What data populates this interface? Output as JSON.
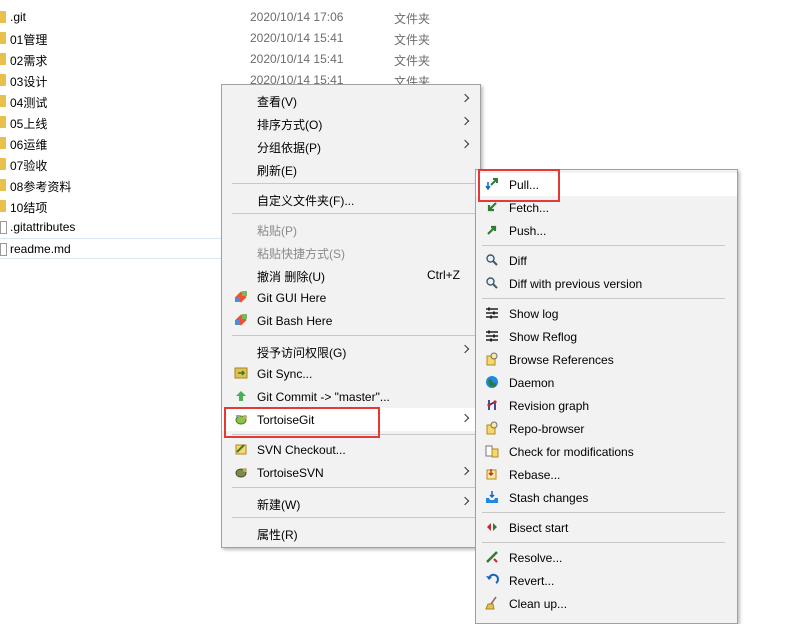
{
  "files": [
    {
      "name": ".git",
      "date": "2020/10/14 17:06",
      "type": "文件夹",
      "icon": "folder-icon"
    },
    {
      "name": "01管理",
      "date": "2020/10/14 15:41",
      "type": "文件夹",
      "icon": "folder-icon"
    },
    {
      "name": "02需求",
      "date": "2020/10/14 15:41",
      "type": "文件夹",
      "icon": "folder-icon"
    },
    {
      "name": "03设计",
      "date": "2020/10/14 15:41",
      "type": "文件夹",
      "icon": "folder-icon"
    },
    {
      "name": "04测试",
      "date": "",
      "type": "",
      "icon": "folder-icon"
    },
    {
      "name": "05上线",
      "date": "",
      "type": "",
      "icon": "folder-icon"
    },
    {
      "name": "06运维",
      "date": "",
      "type": "",
      "icon": "folder-icon"
    },
    {
      "name": "07验收",
      "date": "",
      "type": "",
      "icon": "folder-icon"
    },
    {
      "name": "08参考资料",
      "date": "",
      "type": "",
      "icon": "folder-icon"
    },
    {
      "name": "10结项",
      "date": "",
      "type": "",
      "icon": "folder-icon"
    },
    {
      "name": ".gitattributes",
      "date": "",
      "type": "",
      "icon": "file-icon"
    },
    {
      "name": "readme.md",
      "date": "",
      "type": "",
      "icon": "file-icon"
    }
  ],
  "context_menu": {
    "items": [
      {
        "label": "查看(V)",
        "submenu": true
      },
      {
        "label": "排序方式(O)",
        "submenu": true
      },
      {
        "label": "分组依据(P)",
        "submenu": true
      },
      {
        "label": "刷新(E)"
      },
      {
        "separator": true
      },
      {
        "label": "自定义文件夹(F)..."
      },
      {
        "separator": true
      },
      {
        "label": "粘贴(P)",
        "disabled": true
      },
      {
        "label": "粘贴快捷方式(S)",
        "disabled": true
      },
      {
        "label": "撤消 删除(U)",
        "shortcut": "Ctrl+Z"
      },
      {
        "label": "Git GUI Here",
        "icon": "git-gui-icon"
      },
      {
        "label": "Git Bash Here",
        "icon": "git-bash-icon"
      },
      {
        "separator": true
      },
      {
        "label": "授予访问权限(G)",
        "submenu": true
      },
      {
        "label": "Git Sync...",
        "icon": "git-sync-icon"
      },
      {
        "label": "Git Commit -> \"master\"...",
        "icon": "git-commit-icon"
      },
      {
        "label": "TortoiseGit",
        "submenu": true,
        "icon": "tortoisegit-icon",
        "hover": true
      },
      {
        "separator": true
      },
      {
        "label": "SVN Checkout...",
        "icon": "svn-checkout-icon"
      },
      {
        "label": "TortoiseSVN",
        "submenu": true,
        "icon": "tortoisesvn-icon"
      },
      {
        "separator": true
      },
      {
        "label": "新建(W)",
        "submenu": true
      },
      {
        "separator": true
      },
      {
        "label": "属性(R)"
      }
    ]
  },
  "git_menu": {
    "items": [
      {
        "label": "Pull...",
        "icon": "pull-icon",
        "hover": true
      },
      {
        "label": "Fetch...",
        "icon": "fetch-icon"
      },
      {
        "label": "Push...",
        "icon": "push-icon"
      },
      {
        "separator": true
      },
      {
        "label": "Diff",
        "icon": "diff-icon"
      },
      {
        "label": "Diff with previous version",
        "icon": "diff-previous-icon"
      },
      {
        "separator": true
      },
      {
        "label": "Show log",
        "icon": "show-log-icon"
      },
      {
        "label": "Show Reflog",
        "icon": "show-reflog-icon"
      },
      {
        "label": "Browse References",
        "icon": "browse-references-icon"
      },
      {
        "label": "Daemon",
        "icon": "daemon-icon"
      },
      {
        "label": "Revision graph",
        "icon": "revision-graph-icon"
      },
      {
        "label": "Repo-browser",
        "icon": "repo-browser-icon"
      },
      {
        "label": "Check for modifications",
        "icon": "check-modifications-icon"
      },
      {
        "label": "Rebase...",
        "icon": "rebase-icon"
      },
      {
        "label": "Stash changes",
        "icon": "stash-icon"
      },
      {
        "separator": true
      },
      {
        "label": "Bisect start",
        "icon": "bisect-icon"
      },
      {
        "separator": true
      },
      {
        "label": "Resolve...",
        "icon": "resolve-icon"
      },
      {
        "label": "Revert...",
        "icon": "revert-icon"
      },
      {
        "label": "Clean up...",
        "icon": "cleanup-icon"
      }
    ]
  },
  "colors": {
    "highlight": "#e53935",
    "menu_bg": "#f2f2f2",
    "folder": "#e8c04a"
  }
}
